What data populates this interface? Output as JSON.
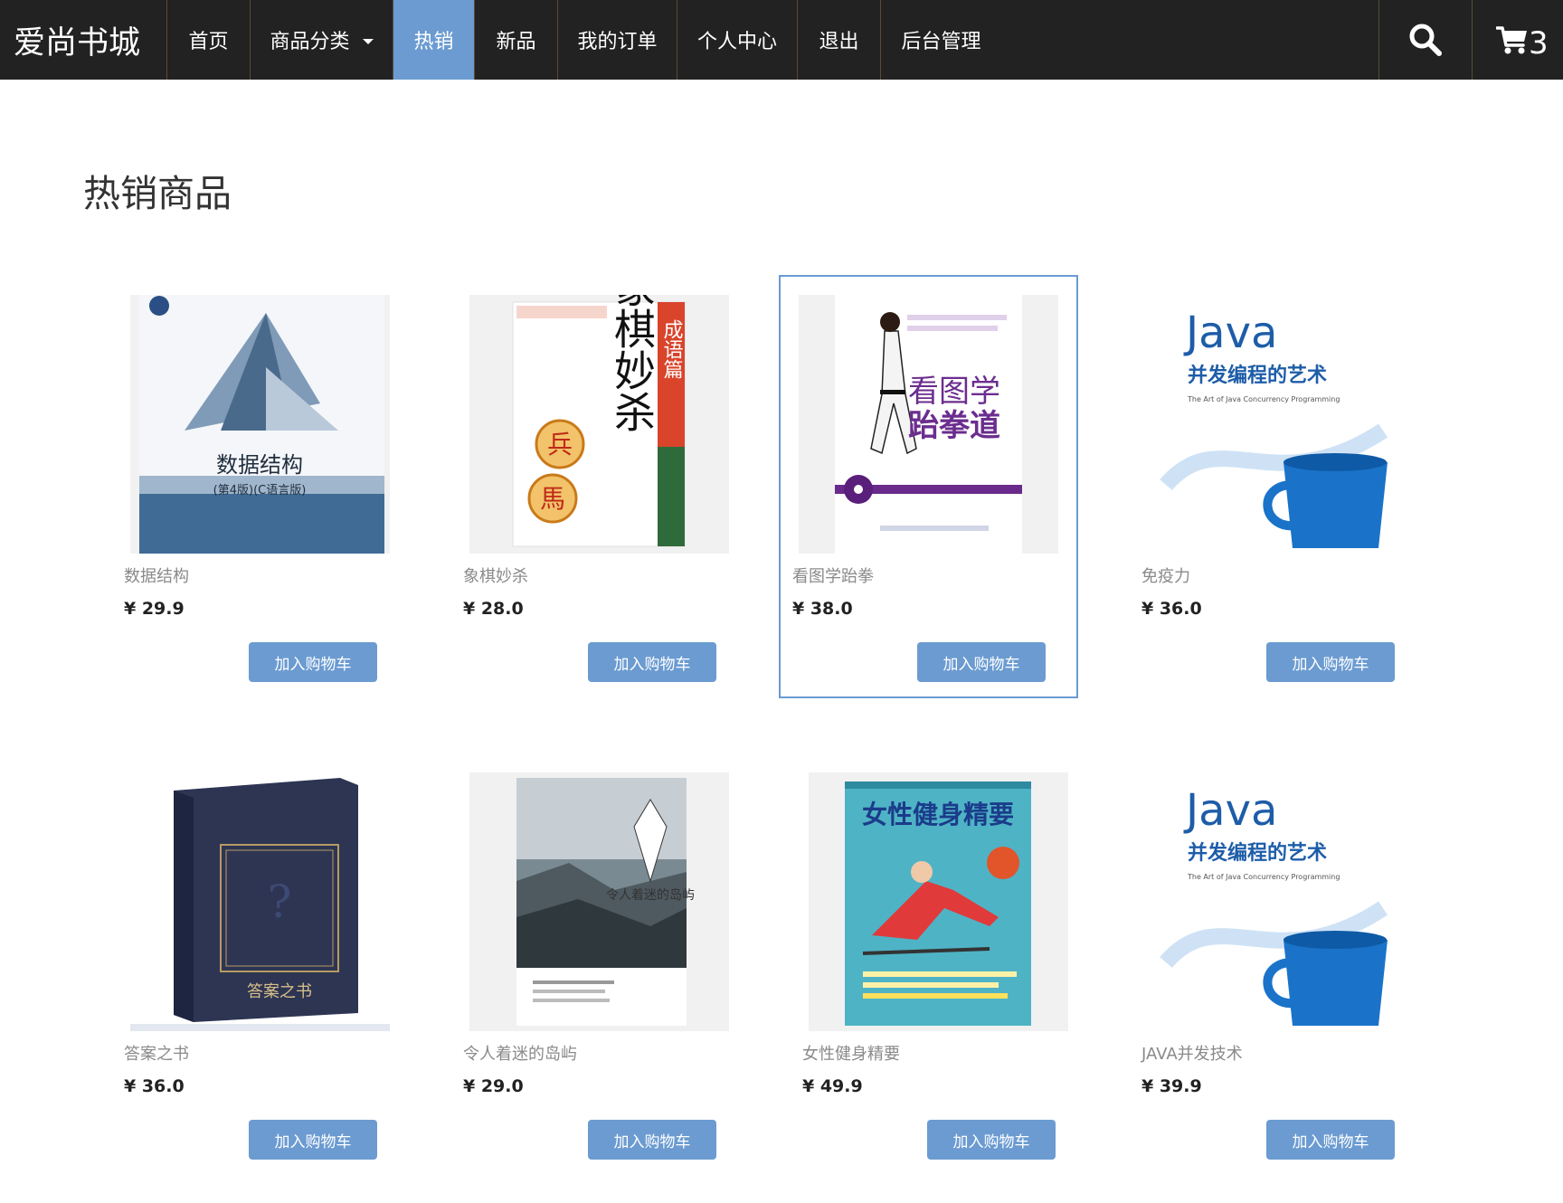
{
  "brand": "爱尚书城",
  "nav": {
    "items": [
      {
        "label": "首页"
      },
      {
        "label": "商品分类"
      },
      {
        "label": "热销"
      },
      {
        "label": "新品"
      },
      {
        "label": "我的订单"
      },
      {
        "label": "个人中心"
      },
      {
        "label": "退出"
      },
      {
        "label": "后台管理"
      }
    ],
    "cart_count": "3"
  },
  "page_title": "热销商品",
  "products": [
    {
      "name": "数据结构",
      "price": "¥ 29.9",
      "button": "加入购物车",
      "cover": {
        "title": "数据结构",
        "subtitle": "(第4版)(C语言版)"
      }
    },
    {
      "name": "象棋妙杀",
      "price": "¥ 28.0",
      "button": "加入购物车",
      "cover": {
        "title": "象棋妙杀",
        "subtitle": "成语篇",
        "chips": [
          "兵",
          "馬"
        ]
      }
    },
    {
      "name": "看图学跆拳",
      "price": "¥ 38.0",
      "button": "加入购物车",
      "cover": {
        "title": "看图学",
        "subtitle": "跆拳道"
      }
    },
    {
      "name": "免疫力",
      "price": "¥ 36.0",
      "button": "加入购物车",
      "cover": {
        "title": "Java",
        "subtitle": "并发编程的艺术",
        "tagline": "The Art of Java Concurrency Programming"
      }
    },
    {
      "name": "答案之书",
      "price": "¥ 36.0",
      "button": "加入购物车",
      "cover": {
        "title": "答案之书"
      }
    },
    {
      "name": "令人着迷的岛屿",
      "price": "¥ 29.0",
      "button": "加入购物车",
      "cover": {
        "title": "令人着迷的岛屿"
      }
    },
    {
      "name": "女性健身精要",
      "price": "¥ 49.9",
      "button": "加入购物车",
      "cover": {
        "title": "女性健身精要"
      }
    },
    {
      "name": "JAVA并发技术",
      "price": "¥ 39.9",
      "button": "加入购物车",
      "cover": {
        "title": "Java",
        "subtitle": "并发编程的艺术",
        "tagline": "The Art of Java Concurrency Programming"
      }
    }
  ],
  "colors": {
    "navbar": "#222222",
    "accent": "#6b9bd1",
    "divider": "#5a4a36"
  }
}
